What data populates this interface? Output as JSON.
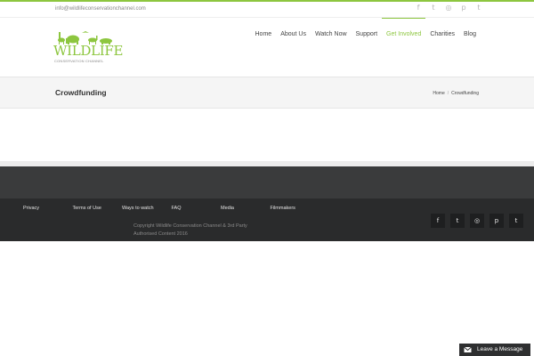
{
  "topbar": {
    "email": "info@wildlifeconservationchannel.com",
    "social_icons": [
      "facebook-icon",
      "twitter-icon",
      "instagram-icon",
      "pinterest-icon",
      "tumblr-icon"
    ]
  },
  "logo": {
    "word": "WILDLIFE",
    "sub": "CONSERVATION CHANNEL"
  },
  "nav": {
    "items": [
      {
        "label": "Home"
      },
      {
        "label": "About Us"
      },
      {
        "label": "Watch Now"
      },
      {
        "label": "Support"
      },
      {
        "label": "Get Involved"
      },
      {
        "label": "Charities"
      },
      {
        "label": "Blog"
      }
    ],
    "active": "Get Involved"
  },
  "titlebar": {
    "title": "Crowdfunding",
    "breadcrumb": [
      "Home",
      "/",
      "Crowdfunding"
    ]
  },
  "footer": {
    "links": [
      "Privacy",
      "Terms of Use",
      "Ways to watch",
      "FAQ",
      "Media",
      "Filmmakers"
    ],
    "copyright": "Copyright Wildlife Conservation Channel & 3rd Party Authorised Content        2016",
    "social_icons": [
      "facebook-icon",
      "twitter-icon",
      "instagram-icon",
      "pinterest-icon",
      "tumblr-icon"
    ]
  },
  "chat": {
    "label": "Leave a Message"
  },
  "colors": {
    "accent": "#8dc63f",
    "footer_dark": "#2a2b2c",
    "footer_mid": "#3a3b3c"
  }
}
